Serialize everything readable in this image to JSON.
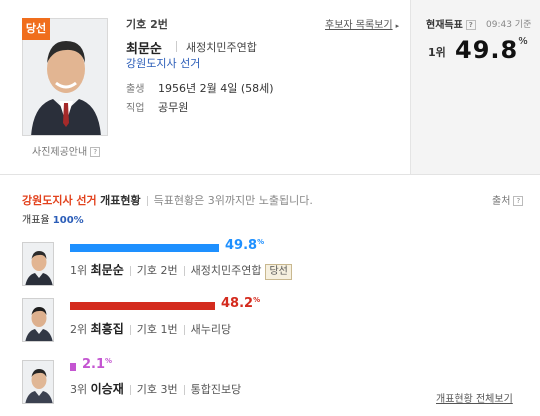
{
  "top": {
    "badge": "당선",
    "photo_info": "사진제공안내",
    "help": "?",
    "number": "기호 2번",
    "name": "최문순",
    "party": "새정치민주연합",
    "link_list": "후보자 목록보기",
    "election": "강원도지사 선거",
    "birth_label": "출생",
    "birth_value": "1956년 2월 4일 (58세)",
    "job_label": "직업",
    "job_value": "공무원"
  },
  "current": {
    "label": "현재득표",
    "time": "09:43 기준",
    "rank": "1위",
    "value": "49.8",
    "unit": "%"
  },
  "status": {
    "title": "강원도지사 선거",
    "title_suffix": "개표현황",
    "note": "득표현황은 3위까지만 노출됩니다.",
    "source": "출처",
    "rate_label": "개표율",
    "rate_value": "100%"
  },
  "candidates": [
    {
      "pct": "49.8",
      "percent": 49.8,
      "unit": "%",
      "color": "#1e90ff",
      "rank": "1위",
      "name": "최문순",
      "number": "기호 2번",
      "party": "새정치민주연합",
      "win": "당선"
    },
    {
      "pct": "48.2",
      "percent": 48.2,
      "unit": "%",
      "color": "#d42b1e",
      "rank": "2위",
      "name": "최흥집",
      "number": "기호 1번",
      "party": "새누리당",
      "win": ""
    },
    {
      "pct": "2.1",
      "percent": 2.1,
      "unit": "%",
      "color": "#c455d1",
      "rank": "3위",
      "name": "이승재",
      "number": "기호 3번",
      "party": "통합진보당",
      "win": ""
    }
  ],
  "footer_link": "개표현황 전체보기",
  "colors": {
    "accent": "#f06e1d",
    "title_red": "#e2411c",
    "link_blue": "#2b5db8"
  },
  "icons": [
    "arrow-right-icon",
    "help-icon",
    "person-photo-icon"
  ]
}
